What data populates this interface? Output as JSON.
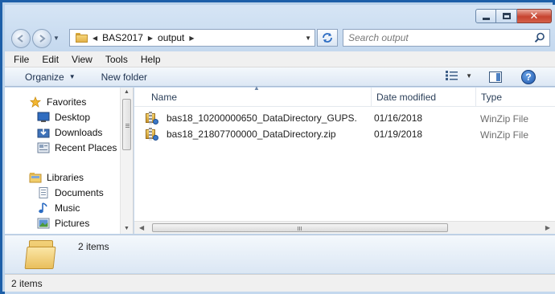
{
  "caption": {
    "close_glyph": "✕"
  },
  "navigation": {
    "breadcrumbs": [
      "BAS2017",
      "output"
    ],
    "search_placeholder": "Search output"
  },
  "menu": [
    "File",
    "Edit",
    "View",
    "Tools",
    "Help"
  ],
  "commands": {
    "organize": "Organize",
    "new_folder": "New folder"
  },
  "nav_pane": {
    "favorites_header": "Favorites",
    "favorites": [
      "Desktop",
      "Downloads",
      "Recent Places"
    ],
    "libraries_header": "Libraries",
    "libraries": [
      "Documents",
      "Music",
      "Pictures"
    ]
  },
  "columns": {
    "name": "Name",
    "date": "Date modified",
    "type": "Type"
  },
  "files": [
    {
      "name": "bas18_10200000650_DataDirectory_GUPS...",
      "date": "01/16/2018",
      "type": "WinZip File"
    },
    {
      "name": "bas18_21807700000_DataDirectory.zip",
      "date": "01/19/2018",
      "type": "WinZip File"
    }
  ],
  "details": {
    "count": "2 items"
  },
  "status": {
    "text": "2 items"
  },
  "colors": {
    "frame": "#1d5fa8",
    "close_button": "#c7432f",
    "header_text": "#2b3f59"
  }
}
